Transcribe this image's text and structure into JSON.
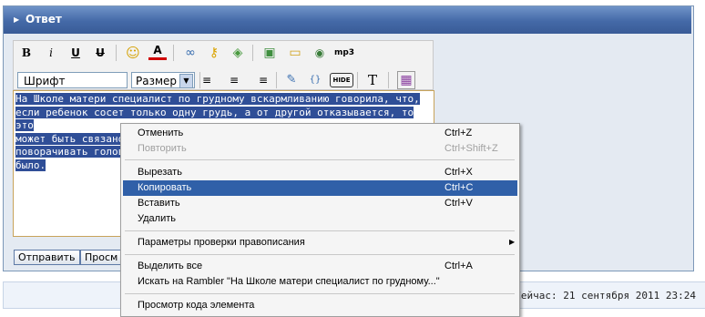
{
  "header": {
    "arrow_icon": "triangle-right-icon",
    "title": "Ответ"
  },
  "toolbar": {
    "row1": [
      {
        "name": "bold-button",
        "glyph": "B"
      },
      {
        "name": "italic-button",
        "glyph": "i"
      },
      {
        "name": "underline-button",
        "glyph": "U"
      },
      {
        "name": "strike-button",
        "glyph": "U"
      },
      {
        "name": "smiley-button",
        "glyph": "☺"
      },
      {
        "name": "text-color-button",
        "glyph": "A"
      },
      {
        "name": "link-button",
        "glyph": "∞"
      },
      {
        "name": "key-button",
        "glyph": "⚷"
      },
      {
        "name": "quote-button",
        "glyph": "◈"
      },
      {
        "name": "image-button",
        "glyph": "▣"
      },
      {
        "name": "folder-button",
        "glyph": "▭"
      },
      {
        "name": "media-button",
        "glyph": "◉"
      },
      {
        "name": "mp3-button",
        "glyph": "mp3"
      }
    ],
    "font_select": "Шрифт",
    "size_select": "Размер",
    "row2": [
      {
        "name": "align-left-button",
        "glyph": "≡"
      },
      {
        "name": "align-center-button",
        "glyph": "≡"
      },
      {
        "name": "align-right-button",
        "glyph": "≡"
      },
      {
        "name": "edit-button",
        "glyph": "✎"
      },
      {
        "name": "code-button",
        "glyph": "{}"
      },
      {
        "name": "hide-button",
        "glyph": "HIDE"
      },
      {
        "name": "text-button",
        "glyph": "T"
      },
      {
        "name": "preview-button",
        "glyph": "▦"
      }
    ]
  },
  "editor": {
    "lines": [
      "На Школе матери специалист по грудному вскармливанию говорила, что,",
      "если ребенок сосет только одну грудь, а от другой отказывается, то это",
      "может быть связано с родовой травмой. То есть ребенку больно",
      "поворачивать голов",
      "было."
    ]
  },
  "buttons": {
    "submit": "Отправить",
    "preview": "Просм"
  },
  "footer": {
    "clock": "Сейчас: 21 сентября 2011 23:24"
  },
  "context_menu": {
    "items": [
      {
        "label": "Отменить",
        "shortcut": "Ctrl+Z"
      },
      {
        "label": "Повторить",
        "shortcut": "Ctrl+Shift+Z"
      },
      {
        "label": "Вырезать",
        "shortcut": "Ctrl+X"
      },
      {
        "label": "Копировать",
        "shortcut": "Ctrl+C"
      },
      {
        "label": "Вставить",
        "shortcut": "Ctrl+V"
      },
      {
        "label": "Удалить",
        "shortcut": ""
      },
      {
        "label": "Параметры проверки правописания",
        "shortcut": ""
      },
      {
        "label": "Выделить все",
        "shortcut": "Ctrl+A"
      },
      {
        "label": "Искать на Rambler \"На Школе матери специалист по грудному...\"",
        "shortcut": ""
      },
      {
        "label": "Просмотр кода элемента",
        "shortcut": ""
      }
    ],
    "highlighted": "Копировать",
    "disabled": [
      "Повторить"
    ],
    "submenu_arrow_icon": "triangle-right-icon"
  }
}
